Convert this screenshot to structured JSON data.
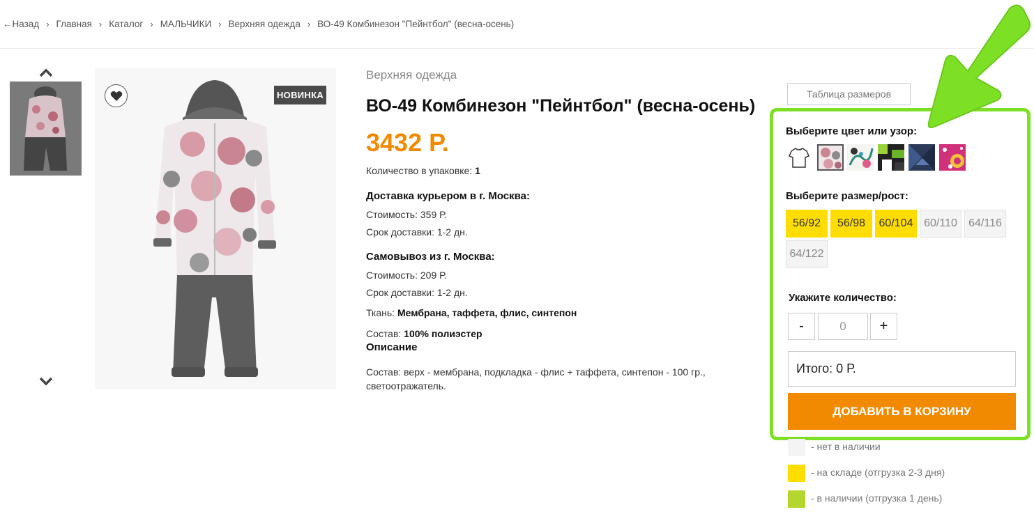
{
  "breadcrumb": {
    "back": "←Назад",
    "items": [
      "Главная",
      "Каталог",
      "МАЛЬЧИКИ",
      "Верхняя одежда",
      "ВО-49 Комбинезон \"Пейнтбол\" (весна-осень)"
    ]
  },
  "gallery": {
    "wishlist_icon": "heart-icon",
    "badge": "НОВИНКА"
  },
  "product": {
    "category": "Верхняя одежда",
    "title": "ВО-49 Комбинезон \"Пейнтбол\" (весна-осень)",
    "price": "3432 Р.",
    "pack_label": "Количество в упаковке:",
    "pack_value": "1",
    "courier_heading": "Доставка курьером в г. Москва:",
    "courier_cost": "Стоимость: 359 Р.",
    "courier_term": "Срок доставки: 1-2 дн.",
    "pickup_heading": "Самовывоз из г. Москва:",
    "pickup_cost": "Стоимость: 209 Р.",
    "pickup_term": "Срок доставки: 1-2 дн.",
    "fabric_label": "Ткань:",
    "fabric_value": "Мембрана, таффета, флис, синтепон",
    "composition_label": "Состав:",
    "composition_value": "100% полиэстер",
    "description_heading": "Описание",
    "description_line1": "Состав: верх - мембрана, подкладка - флис + таффета, синтепон - 100 гр.,",
    "description_line2": "светоотражатель."
  },
  "options": {
    "size_table": "Таблица размеров",
    "color_label": "Выберите цвет или узор:",
    "size_label": "Выберите размер/рост:",
    "sizes": [
      {
        "label": "56/92",
        "status": "stock"
      },
      {
        "label": "56/98",
        "status": "stock"
      },
      {
        "label": "60/104",
        "status": "stock"
      },
      {
        "label": "60/110",
        "status": "none"
      },
      {
        "label": "64/116",
        "status": "none"
      },
      {
        "label": "64/122",
        "status": "none"
      }
    ],
    "qty_label": "Укажите количество:",
    "minus": "-",
    "qty_value": "0",
    "plus": "+",
    "total": "Итого: 0 Р.",
    "add_to_cart": "ДОБАВИТЬ В КОРЗИНУ"
  },
  "legend": [
    {
      "text": "- нет в наличии",
      "color": "#f4f4f4"
    },
    {
      "text": "- на складе (отгрузка 2-3 дня)",
      "color": "#ffdd00"
    },
    {
      "text": "- в наличии (отгрузка 1 день)",
      "color": "#b5d62e"
    }
  ],
  "colors": {
    "accent": "#f28a00",
    "highlight": "#7ee024",
    "size_available": "#ffdd00"
  }
}
